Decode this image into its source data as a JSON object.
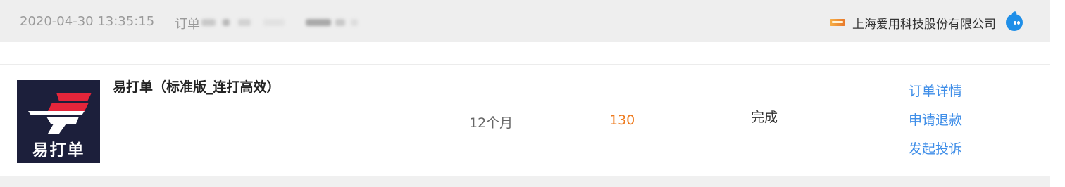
{
  "order": {
    "time": "2020-04-30 13:35:15",
    "order_no_label": "订单"
  },
  "shop": {
    "logo_icon": "shop-logo-icon",
    "name": "上海爱用科技股份有限公司",
    "chat_icon": "chat-icon",
    "chat_color": "#1f8fe8"
  },
  "item": {
    "thumb_text": "易打单",
    "title": "易打单（标准版_连打高效）",
    "duration": "12个月",
    "price": "130",
    "status": "完成"
  },
  "actions": {
    "detail": "订单详情",
    "refund": "申请退款",
    "complain": "发起投诉"
  },
  "colors": {
    "price": "#ee7a1d",
    "link": "#3f8ee8",
    "header_bg": "#eeeeee",
    "thumb_bg": "#1c1f3b"
  }
}
